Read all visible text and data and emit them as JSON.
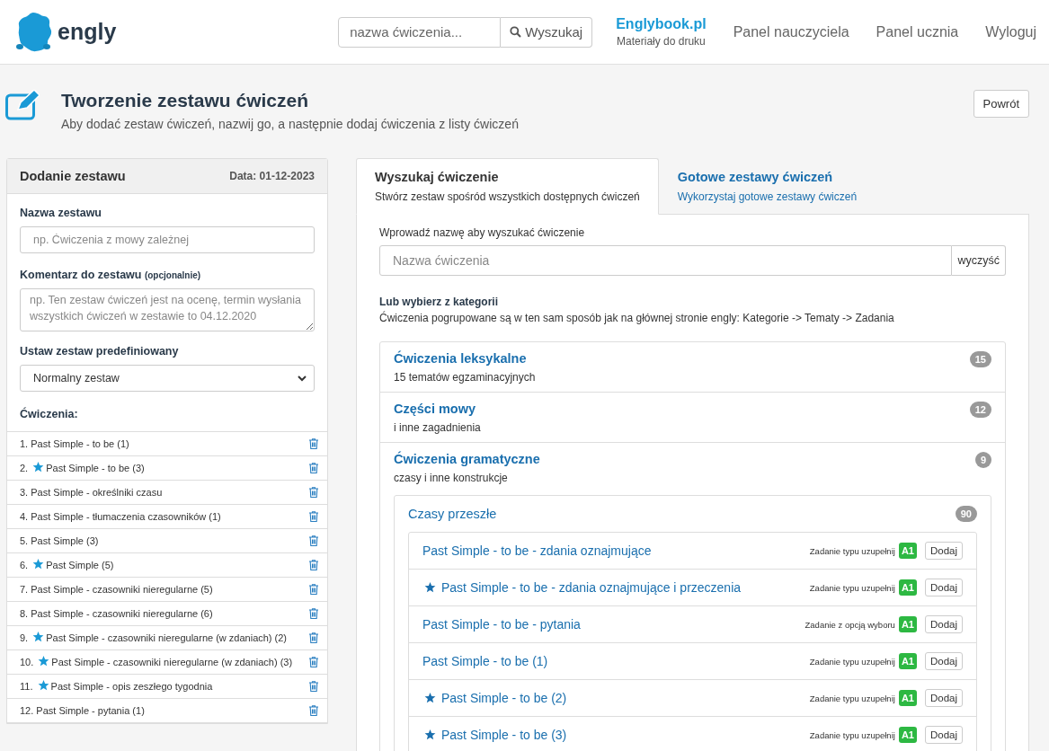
{
  "header": {
    "logo_text": "engly",
    "search": {
      "placeholder": "nazwa ćwiczenia...",
      "button": "Wyszukaj"
    },
    "nav": [
      {
        "kind": "brand",
        "label": "Englybook.pl",
        "sub": "Materiały do druku"
      },
      {
        "kind": "link",
        "label": "Panel nauczyciela"
      },
      {
        "kind": "link",
        "label": "Panel ucznia"
      },
      {
        "kind": "link",
        "label": "Wyloguj"
      }
    ]
  },
  "page": {
    "title": "Tworzenie zestawu ćwiczeń",
    "subtitle": "Aby dodać zestaw ćwiczeń, nazwij go, a następnie dodaj ćwiczenia z listy ćwiczeń",
    "back_button": "Powrót"
  },
  "set_panel": {
    "title": "Dodanie zestawu",
    "date": "Data: 01-12-2023",
    "name_label": "Nazwa zestawu",
    "name_placeholder": "np. Ćwiczenia z mowy zależnej",
    "comment_label": "Komentarz do zestawu",
    "comment_hint": "(opcjonalnie)",
    "comment_placeholder": "np. Ten zestaw ćwiczeń jest na ocenę, termin wysłania wszystkich ćwiczeń w zestawie to 04.12.2020",
    "preset_label": "Ustaw zestaw predefiniowany",
    "preset_value": "Normalny zestaw",
    "exercises_label": "Ćwiczenia:",
    "exercises": [
      {
        "number": "1.",
        "starred": false,
        "title": "Past Simple - to be (1)"
      },
      {
        "number": "2.",
        "starred": true,
        "title": "Past Simple - to be (3)"
      },
      {
        "number": "3.",
        "starred": false,
        "title": "Past Simple - określniki czasu"
      },
      {
        "number": "4.",
        "starred": false,
        "title": "Past Simple - tłumaczenia czasowników (1)"
      },
      {
        "number": "5.",
        "starred": false,
        "title": "Past Simple (3)"
      },
      {
        "number": "6.",
        "starred": true,
        "title": "Past Simple (5)"
      },
      {
        "number": "7.",
        "starred": false,
        "title": "Past Simple - czasowniki nieregularne (5)"
      },
      {
        "number": "8.",
        "starred": false,
        "title": "Past Simple - czasowniki nieregularne (6)"
      },
      {
        "number": "9.",
        "starred": true,
        "title": "Past Simple - czasowniki nieregularne (w zdaniach) (2)"
      },
      {
        "number": "10.",
        "starred": true,
        "title": "Past Simple - czasowniki nieregularne (w zdaniach) (3)"
      },
      {
        "number": "11.",
        "starred": true,
        "title": "Past Simple - opis zeszłego tygodnia"
      },
      {
        "number": "12.",
        "starred": false,
        "title": "Past Simple - pytania (1)"
      }
    ]
  },
  "tabs": [
    {
      "title": "Wyszukaj ćwiczenie",
      "subtitle": "Stwórz zestaw spośród wszystkich dostępnych ćwiczeń",
      "selected": true
    },
    {
      "title": "Gotowe zestawy ćwiczeń",
      "subtitle": "Wykorzystaj gotowe zestawy ćwiczeń",
      "selected": false
    }
  ],
  "search_tab": {
    "search_label": "Wprowadź nazwę aby wyszukać ćwiczenie",
    "search_placeholder": "Nazwa ćwiczenia",
    "clear_button": "wyczyść",
    "categories_label": "Lub wybierz z kategorii",
    "categories_hint": "Ćwiczenia pogrupowane są w ten sam sposób jak na głównej stronie engly: Kategorie -> Tematy -> Zadania",
    "categories": [
      {
        "title": "Ćwiczenia leksykalne",
        "subtitle": "15 tematów egzaminacyjnych",
        "count": "15"
      },
      {
        "title": "Części mowy",
        "subtitle": "i inne zagadnienia",
        "count": "12"
      },
      {
        "title": "Ćwiczenia gramatyczne",
        "subtitle": "czasy i inne konstrukcje",
        "count": "9",
        "children": [
          {
            "title": "Czasy przeszłe",
            "count": "90",
            "exercises": [
              {
                "title": "Past Simple - to be - zdania oznajmujące",
                "starred": false,
                "type": "Zadanie typu uzupełnij",
                "level": "A1",
                "button": "Dodaj"
              },
              {
                "title": "Past Simple - to be - zdania oznajmujące i przeczenia",
                "starred": true,
                "type": "Zadanie typu uzupełnij",
                "level": "A1",
                "button": "Dodaj"
              },
              {
                "title": "Past Simple - to be - pytania",
                "starred": false,
                "type": "Zadanie z opcją wyboru",
                "level": "A1",
                "button": "Dodaj"
              },
              {
                "title": "Past Simple - to be (1)",
                "starred": false,
                "type": "Zadanie typu uzupełnij",
                "level": "A1",
                "button": "Dodaj"
              },
              {
                "title": "Past Simple - to be (2)",
                "starred": true,
                "type": "Zadanie typu uzupełnij",
                "level": "A1",
                "button": "Dodaj"
              },
              {
                "title": "Past Simple - to be (3)",
                "starred": true,
                "type": "Zadanie typu uzupełnij",
                "level": "A1",
                "button": "Dodaj"
              }
            ]
          }
        ]
      }
    ]
  }
}
